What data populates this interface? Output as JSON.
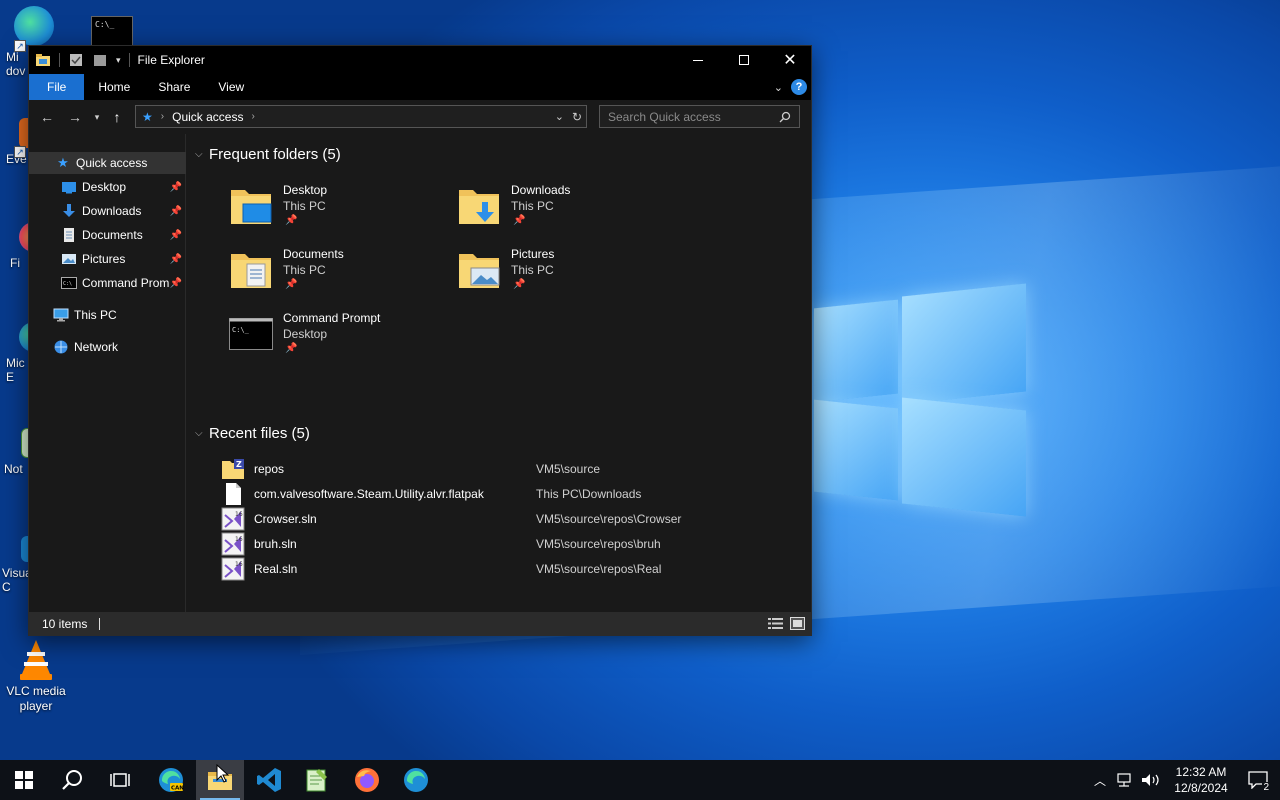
{
  "colors": {
    "accent": "#1a6fd0",
    "window_bg": "#191919",
    "titlebar_bg": "#000000",
    "statusbar_bg": "#2b2b2b",
    "folder_yellow": "#f8d775",
    "taskbar_bg": "#0d1117"
  },
  "desktop": {
    "icons": [
      {
        "label": "Mi\ndov",
        "icon": "edge-icon"
      },
      {
        "label": "Eve",
        "icon": "app-icon"
      },
      {
        "label": "Fi",
        "icon": "firefox-icon"
      },
      {
        "label": "Mic\nE",
        "icon": "edge-icon"
      },
      {
        "label": "Not",
        "icon": "notepad-icon"
      },
      {
        "label": "Visua\nC",
        "icon": "vscode-icon"
      },
      {
        "label": "VLC media player",
        "icon": "vlc-icon"
      }
    ],
    "cmd_thumb": "C:\\_"
  },
  "window": {
    "title": "File Explorer",
    "ribbon_tabs": [
      "File",
      "Home",
      "Share",
      "View"
    ],
    "address": {
      "location": "Quick access"
    },
    "search_placeholder": "Search Quick access",
    "status_items": "10 items"
  },
  "navpane": {
    "quick_access": "Quick access",
    "pinned": [
      {
        "label": "Desktop",
        "icon": "desktop-folder-icon"
      },
      {
        "label": "Downloads",
        "icon": "downloads-icon"
      },
      {
        "label": "Documents",
        "icon": "documents-icon"
      },
      {
        "label": "Pictures",
        "icon": "pictures-icon"
      },
      {
        "label": "Command Prom",
        "icon": "cmd-icon"
      }
    ],
    "this_pc": "This PC",
    "network": "Network"
  },
  "frequent": {
    "header": "Frequent folders (5)",
    "items": [
      {
        "name": "Desktop",
        "location": "This PC",
        "icon": "desktop-folder-icon"
      },
      {
        "name": "Downloads",
        "location": "This PC",
        "icon": "downloads-folder-icon"
      },
      {
        "name": "Documents",
        "location": "This PC",
        "icon": "documents-folder-icon"
      },
      {
        "name": "Pictures",
        "location": "This PC",
        "icon": "pictures-folder-icon"
      },
      {
        "name": "Command Prompt",
        "location": "Desktop",
        "icon": "cmd-icon"
      }
    ]
  },
  "recent": {
    "header": "Recent files (5)",
    "items": [
      {
        "name": "repos",
        "path": "VM5\\source",
        "icon": "zip-folder-icon"
      },
      {
        "name": "com.valvesoftware.Steam.Utility.alvr.flatpak",
        "path": "This PC\\Downloads",
        "icon": "file-icon"
      },
      {
        "name": "Crowser.sln",
        "path": "VM5\\source\\repos\\Crowser",
        "icon": "vs-solution-icon"
      },
      {
        "name": "bruh.sln",
        "path": "VM5\\source\\repos\\bruh",
        "icon": "vs-solution-icon"
      },
      {
        "name": "Real.sln",
        "path": "VM5\\source\\repos\\Real",
        "icon": "vs-solution-icon"
      }
    ]
  },
  "taskbar": {
    "apps": [
      "start",
      "search",
      "task-view",
      "edge-can",
      "file-explorer",
      "vscode",
      "notepadpp",
      "firefox",
      "edge"
    ],
    "time": "12:32 AM",
    "date": "12/8/2024",
    "notifications": "2"
  }
}
